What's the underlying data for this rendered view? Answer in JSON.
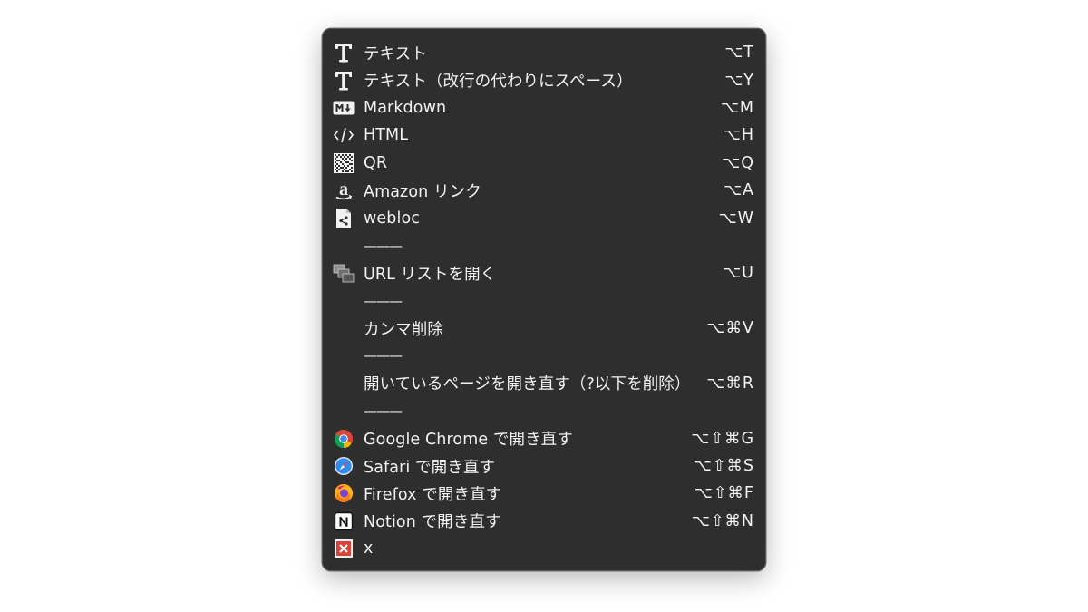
{
  "menu": {
    "items": [
      {
        "label": "テキスト",
        "shortcut": "⌥T",
        "icon": "text-t-icon"
      },
      {
        "label": "テキスト（改行の代わりにスペース）",
        "shortcut": "⌥Y",
        "icon": "text-t-icon"
      },
      {
        "label": "Markdown",
        "shortcut": "⌥M",
        "icon": "markdown-icon"
      },
      {
        "label": "HTML",
        "shortcut": "⌥H",
        "icon": "html-code-icon"
      },
      {
        "label": "QR",
        "shortcut": "⌥Q",
        "icon": "qr-code-icon"
      },
      {
        "label": "Amazon リンク",
        "shortcut": "⌥A",
        "icon": "amazon-icon"
      },
      {
        "label": "webloc",
        "shortcut": "⌥W",
        "icon": "webloc-file-icon"
      },
      {
        "label": "———",
        "separator": true
      },
      {
        "label": "URL リストを開く",
        "shortcut": "⌥U",
        "icon": "url-list-icon"
      },
      {
        "label": "———",
        "separator": true
      },
      {
        "label": "カンマ削除",
        "shortcut": "⌥⌘V"
      },
      {
        "label": "———",
        "separator": true
      },
      {
        "label": "開いているページを開き直す（?以下を削除）",
        "shortcut": "⌥⌘R"
      },
      {
        "label": "———",
        "separator": true
      },
      {
        "label": "Google Chrome で開き直す",
        "shortcut": "⌥⇧⌘G",
        "icon": "chrome-icon"
      },
      {
        "label": "Safari で開き直す",
        "shortcut": "⌥⇧⌘S",
        "icon": "safari-icon"
      },
      {
        "label": "Firefox で開き直す",
        "shortcut": "⌥⇧⌘F",
        "icon": "firefox-icon"
      },
      {
        "label": "Notion で開き直す",
        "shortcut": "⌥⇧⌘N",
        "icon": "notion-icon"
      },
      {
        "label": "x",
        "icon": "close-x-icon"
      }
    ]
  },
  "colors": {
    "menu_background": "#2e2e2e",
    "text": "#f2f2f2",
    "close_icon_red": "#d9443a"
  }
}
